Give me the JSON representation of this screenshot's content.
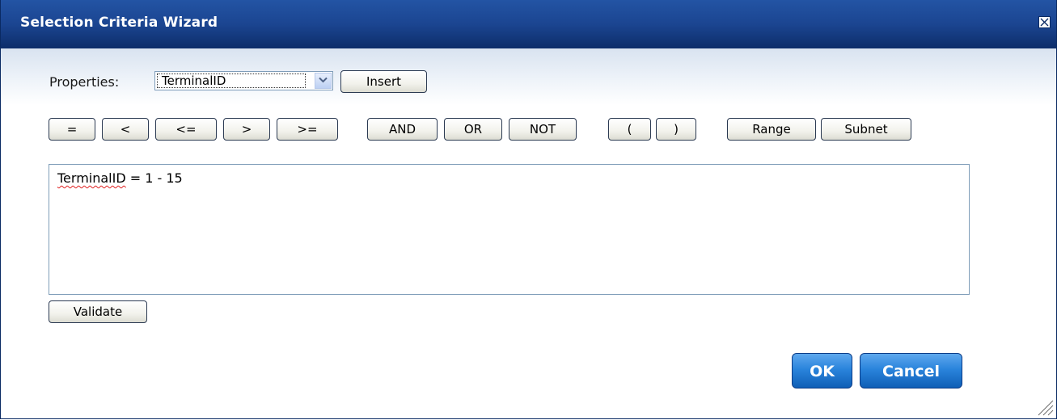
{
  "dialog": {
    "title": "Selection Criteria Wizard",
    "close_icon": "close-icon"
  },
  "properties": {
    "label": "Properties:",
    "selected": "TerminalID",
    "insert_label": "Insert"
  },
  "operators": {
    "eq": "=",
    "lt": "<",
    "le": "<=",
    "gt": ">",
    "ge": ">=",
    "and": "AND",
    "or": "OR",
    "not": "NOT",
    "lparen": "(",
    "rparen": ")",
    "range": "Range",
    "subnet": "Subnet"
  },
  "criteria": {
    "property": "TerminalID",
    "expression": " = 1 - 15"
  },
  "actions": {
    "validate_label": "Validate",
    "ok_label": "OK",
    "cancel_label": "Cancel"
  },
  "colors": {
    "titlebar": "#1b4591",
    "primary_button": "#2a84dc"
  }
}
